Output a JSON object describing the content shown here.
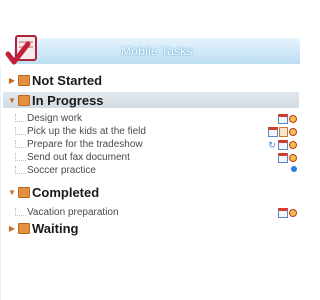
{
  "app": {
    "title": "Mobile Tasks"
  },
  "groups": [
    {
      "label": "Not Started"
    },
    {
      "label": "In Progress"
    },
    {
      "label": "Completed"
    },
    {
      "label": "Waiting"
    }
  ],
  "tasks": [
    {
      "text": "Design work",
      "group": "In Progress",
      "icons": [
        "calendar-icon",
        "alarm-icon"
      ]
    },
    {
      "text": "Pick up the kids at the field",
      "group": "In Progress",
      "icons": [
        "calendar-icon",
        "note-icon",
        "alarm-icon"
      ]
    },
    {
      "text": "Prepare for the tradeshow",
      "group": "In Progress",
      "icons": [
        "recurring-icon",
        "calendar-icon",
        "alarm-icon"
      ]
    },
    {
      "text": "Send out fax document",
      "group": "In Progress",
      "icons": [
        "calendar-icon",
        "alarm-icon"
      ]
    },
    {
      "text": "Soccer practice",
      "group": "In Progress",
      "icons": [
        "reminder-dot-icon"
      ]
    },
    {
      "text": "Vacation preparation",
      "group": "Completed",
      "icons": [
        "calendar-icon",
        "alarm-icon"
      ]
    }
  ],
  "colors": {
    "title_bar": "#bcdff3",
    "selected_row": "#d3dbe2",
    "folder": "#e4903e"
  }
}
